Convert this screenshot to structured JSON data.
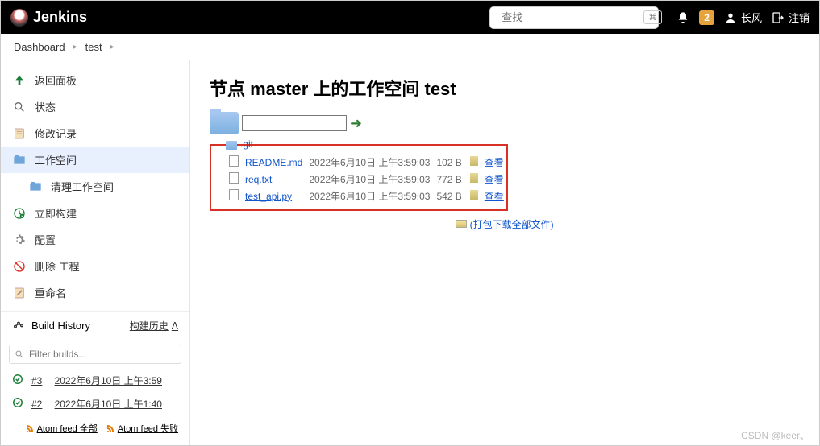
{
  "brand": "Jenkins",
  "search": {
    "placeholder": "查找",
    "kbd": "⌘"
  },
  "topbar": {
    "badge": "2",
    "user": "长风",
    "logout": "注销"
  },
  "breadcrumb": [
    {
      "label": "Dashboard"
    },
    {
      "label": "test"
    }
  ],
  "sidebar": {
    "items": [
      {
        "label": "返回面板"
      },
      {
        "label": "状态"
      },
      {
        "label": "修改记录"
      },
      {
        "label": "工作空间"
      },
      {
        "label": "清理工作空间"
      },
      {
        "label": "立即构建"
      },
      {
        "label": "配置"
      },
      {
        "label": "删除 工程"
      },
      {
        "label": "重命名"
      }
    ],
    "build_history_title": "Build History",
    "build_history_sub": "构建历史",
    "filter_placeholder": "Filter builds...",
    "builds": [
      {
        "num": "#3",
        "date": "2022年6月10日 上午3:59"
      },
      {
        "num": "#2",
        "date": "2022年6月10日 上午1:40"
      }
    ],
    "atom_all": "Atom feed 全部",
    "atom_fail": "Atom feed 失败"
  },
  "main": {
    "title": "节点 master 上的工作空间 test",
    "path_value": "",
    "git_label": ".git",
    "files": [
      {
        "name": "README.md",
        "date": "2022年6月10日 上午3:59:03",
        "size": "102 B",
        "view": "查看"
      },
      {
        "name": "req.txt",
        "date": "2022年6月10日 上午3:59:03",
        "size": "772 B",
        "view": "查看"
      },
      {
        "name": "test_api.py",
        "date": "2022年6月10日 上午3:59:03",
        "size": "542 B",
        "view": "查看"
      }
    ],
    "download_all": "(打包下载全部文件)"
  },
  "watermark": "CSDN @keer、"
}
